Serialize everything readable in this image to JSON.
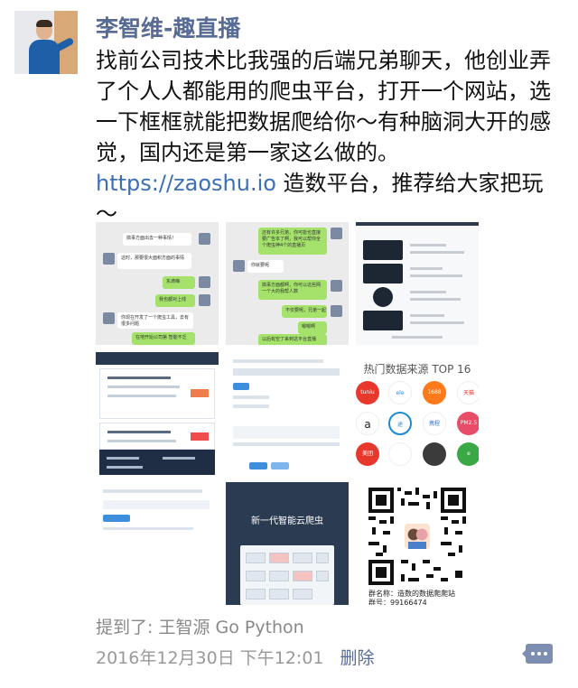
{
  "post": {
    "author": "李智维-趣直播",
    "text_before_link": "找前公司技术比我强的后端兄弟聊天，他创业弄了个人人都能用的爬虫平台，打开一个网站，选一下框框就能把数据爬给你～有种脑洞大开的感觉，国内还是第一家这么做的。",
    "link": "https://zaoshu.io",
    "text_after_link": " 造数平台，推荐给大家把玩～"
  },
  "images": {
    "img1": {
      "bubbles": [
        "搞事方面出去一种事情！",
        "这时，那要很大面积方面的事情",
        "东滴嗨",
        "我也都对上线",
        "你现在开发了一个爬虫工具，去有很多问题",
        "在地开始公司第 智能不乏"
      ]
    },
    "img2": {
      "bubbles": [
        "还有许多兄弟，你可能也直接要广告本了啊，我可以帮你全个爬虫神4个的直播页",
        "你就要呢",
        "搞事方面都啊，你可以这些网一个大的我帮人数",
        "不仅要呢，兄弟一起",
        "嗯嗯啊",
        "以后有空了来到这平台直播"
      ]
    },
    "img6": {
      "title": "热门数据来源 TOP 16",
      "sources": [
        "tuniu",
        "ele",
        "1688",
        "天猫",
        "a",
        "途",
        "携程",
        "PM2.5",
        "美团",
        "e"
      ]
    },
    "img8": {
      "title": "新一代智能云爬虫"
    },
    "img9": {
      "group_name": "群名称：造数的数据爬爬站",
      "group_id": "群号：99166474"
    }
  },
  "footer": {
    "mention": "提到了: 王智源 Go Python",
    "timestamp": "2016年12月30日 下午12:01",
    "delete_label": "删除"
  },
  "colors": {
    "name_blue": "#576b95",
    "link_blue": "#3b6fb6",
    "chat_green": "#a4e26c",
    "meta_gray": "#999999"
  }
}
